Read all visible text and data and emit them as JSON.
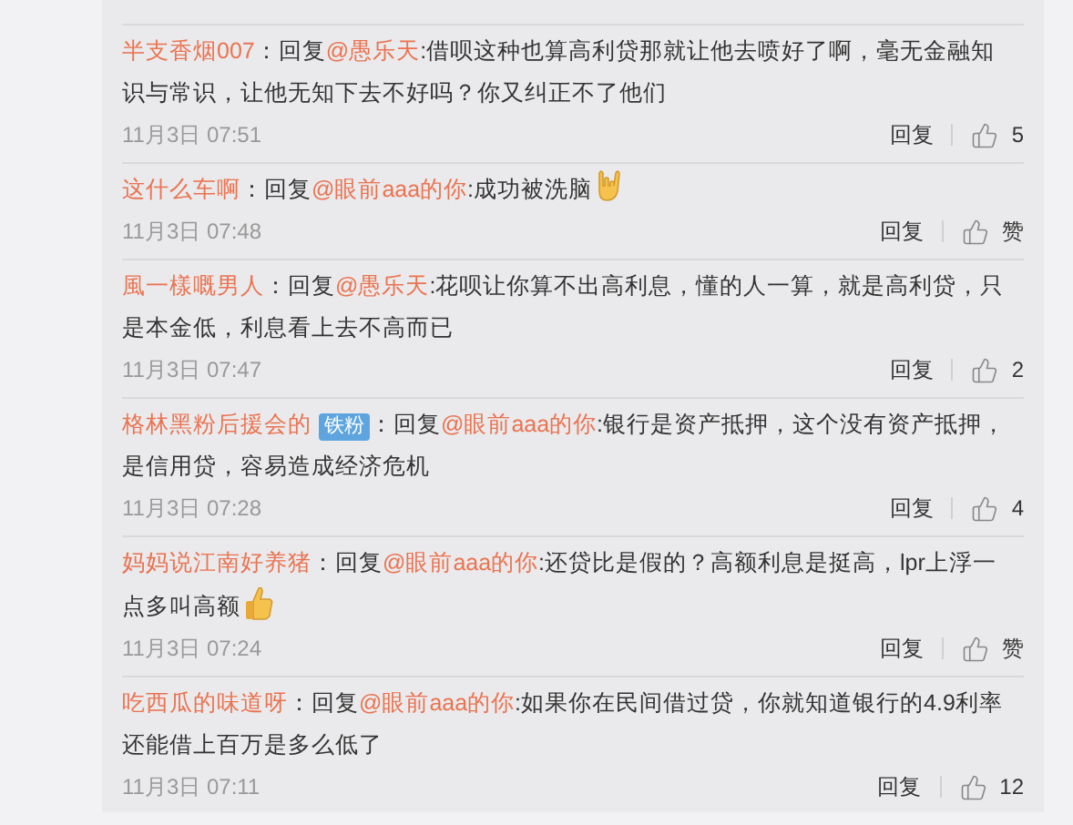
{
  "comments": [
    {
      "user": "半支香烟007",
      "prefix": "：回复",
      "mention": "@愚乐天",
      "text": ":借呗这种也算高利贷那就让他去喷好了啊，毫无金融知识与常识，让他无知下去不好吗？你又纠正不了他们",
      "date": "11月3日 07:51",
      "reply": "回复",
      "likes": "5"
    },
    {
      "user": "这什么车啊",
      "prefix": "：回复",
      "mention": "@眼前aaa的你",
      "text": ":成功被洗脑",
      "kind": "rockhand",
      "date": "11月3日 07:48",
      "reply": "回复",
      "likes": "赞"
    },
    {
      "user": "風一樣嘅男人",
      "prefix": "：回复",
      "mention": "@愚乐天",
      "text": ":花呗让你算不出高利息，懂的人一算，就是高利贷，只是本金低，利息看上去不高而已",
      "date": "11月3日 07:47",
      "reply": "回复",
      "likes": "2"
    },
    {
      "user": "格林黑粉后援会的",
      "badge": "铁粉",
      "prefix": "：回复",
      "mention": "@眼前aaa的你",
      "text": ":银行是资产抵押，这个没有资产抵押，是信用贷，容易造成经济危机",
      "date": "11月3日 07:28",
      "reply": "回复",
      "likes": "4"
    },
    {
      "user": "妈妈说江南好养猪",
      "prefix": "：回复",
      "mention": "@眼前aaa的你",
      "text": ":还贷比是假的？高额利息是挺高，lpr上浮一点多叫高额",
      "kind": "thumbsup",
      "date": "11月3日 07:24",
      "reply": "回复",
      "likes": "赞"
    },
    {
      "user": "吃西瓜的味道呀",
      "prefix": "：回复",
      "mention": "@眼前aaa的你",
      "text": ":如果你在民间借过贷，你就知道银行的4.9利率还能借上百万是多么低了",
      "date": "11月3日 07:11",
      "reply": "回复",
      "likes": "12"
    }
  ]
}
